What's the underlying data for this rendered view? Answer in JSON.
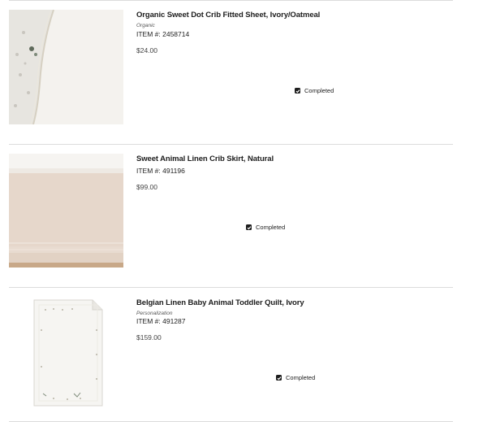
{
  "items": [
    {
      "title": "Organic Sweet Dot Crib Fitted Sheet, Ivory/Oatmeal",
      "tag": "Organic",
      "sku": "ITEM #: 2458714",
      "price": "$24.00",
      "status": "Completed"
    },
    {
      "title": "Sweet Animal Linen Crib Skirt, Natural",
      "sku": "ITEM #: 491196",
      "price": "$99.00",
      "status": "Completed"
    },
    {
      "title": "Belgian Linen Baby Animal Toddler Quilt, Ivory",
      "tag": "Personalization",
      "sku": "ITEM #: 491287",
      "price": "$159.00",
      "status": "Completed"
    }
  ],
  "colors": {
    "text": "#1d1d1d",
    "divider": "#dcdcdc",
    "checkbox": "#1d1d1d"
  }
}
